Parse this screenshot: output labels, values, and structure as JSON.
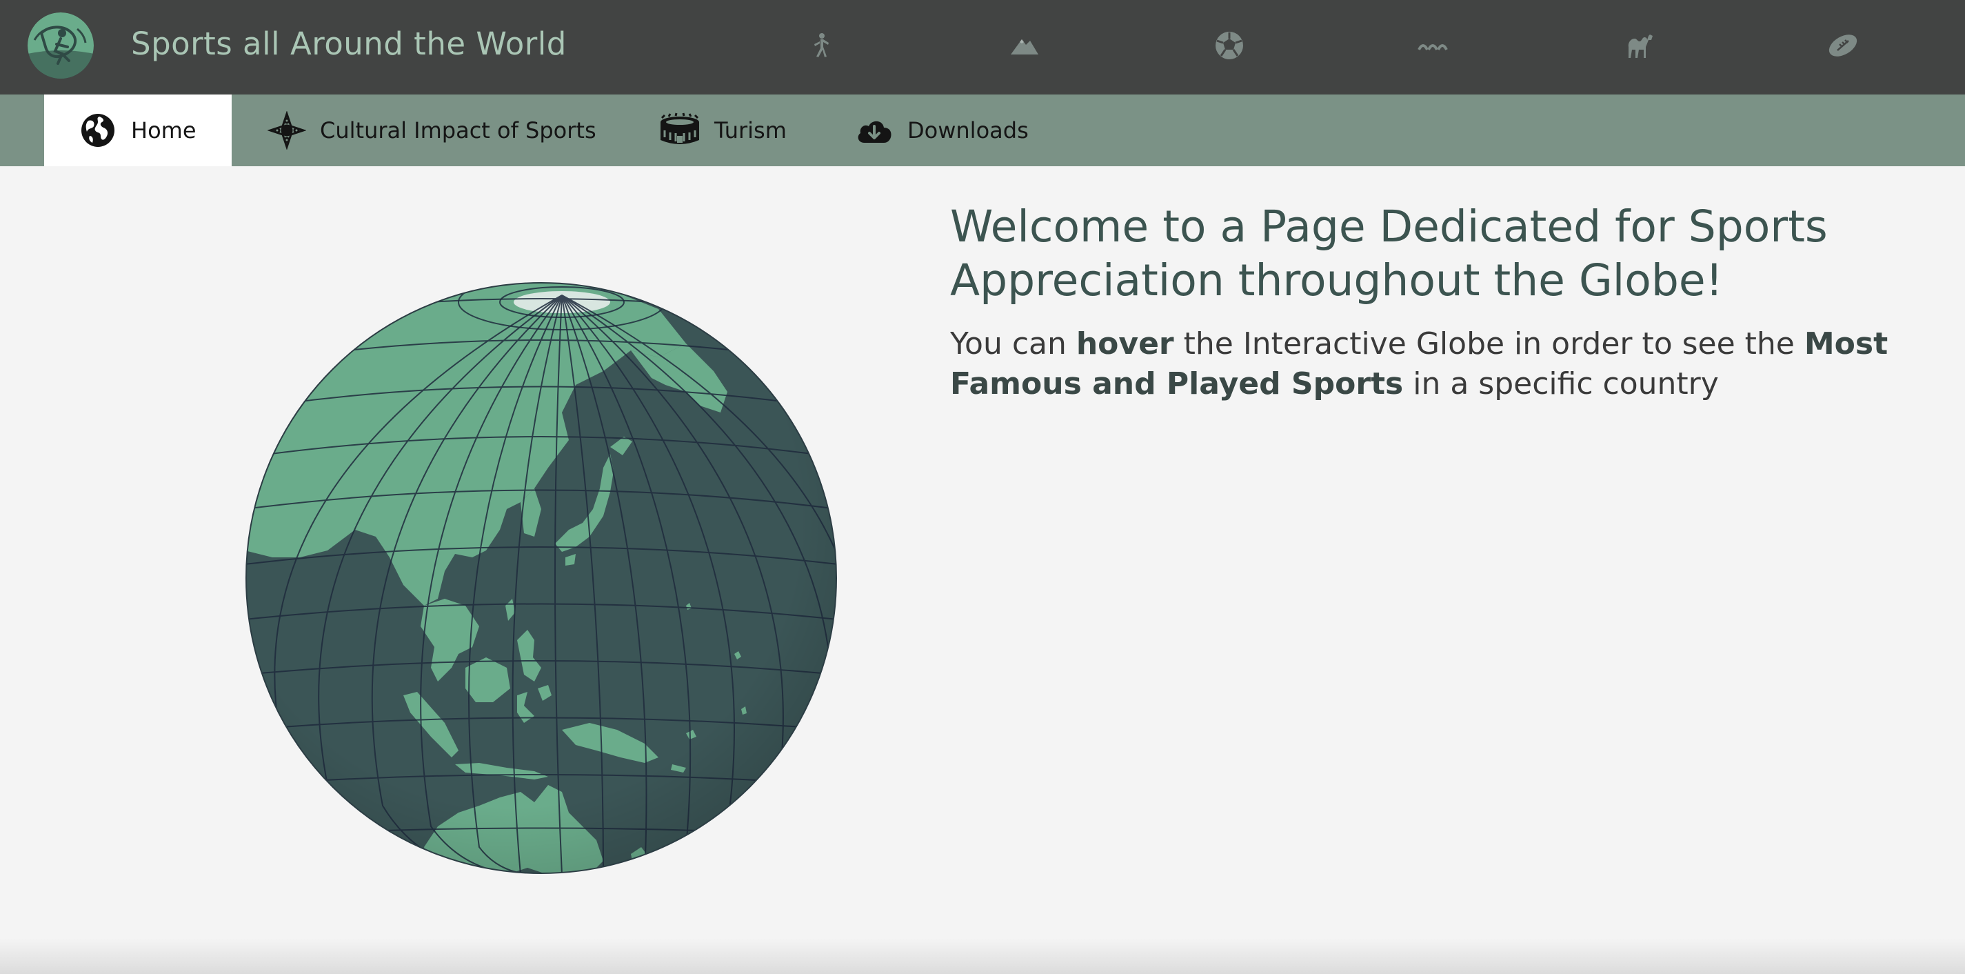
{
  "header": {
    "title": "Sports all Around the World",
    "logo_icon": "globe-runner-logo",
    "sport_icons": [
      "athletics-icon",
      "mountain-icon",
      "soccer-ball-icon",
      "waves-icon",
      "camel-icon",
      "american-football-icon"
    ]
  },
  "nav": {
    "tabs": [
      {
        "label": "Home",
        "icon": "globe-icon",
        "active": true
      },
      {
        "label": "Cultural Impact of Sports",
        "icon": "compass-ornament-icon",
        "active": false
      },
      {
        "label": "Turism",
        "icon": "stadium-icon",
        "active": false
      },
      {
        "label": "Downloads",
        "icon": "cloud-download-icon",
        "active": false
      }
    ]
  },
  "main": {
    "heading": "Welcome to a Page Dedicated for Sports Appreciation throughout the Globe!",
    "intro": {
      "part1": "You can ",
      "bold1": "hover",
      "part2": " the Interactive Globe in order to see the ",
      "bold2": "Most Famous and Played Sports",
      "part3": " in a specific country"
    }
  },
  "colors": {
    "header_bg": "#424443",
    "nav_bg": "#7b9286",
    "ocean": "#3b5556",
    "land": "#6aac8b",
    "graticule": "#1f2b3d",
    "heading": "#3c5450"
  }
}
